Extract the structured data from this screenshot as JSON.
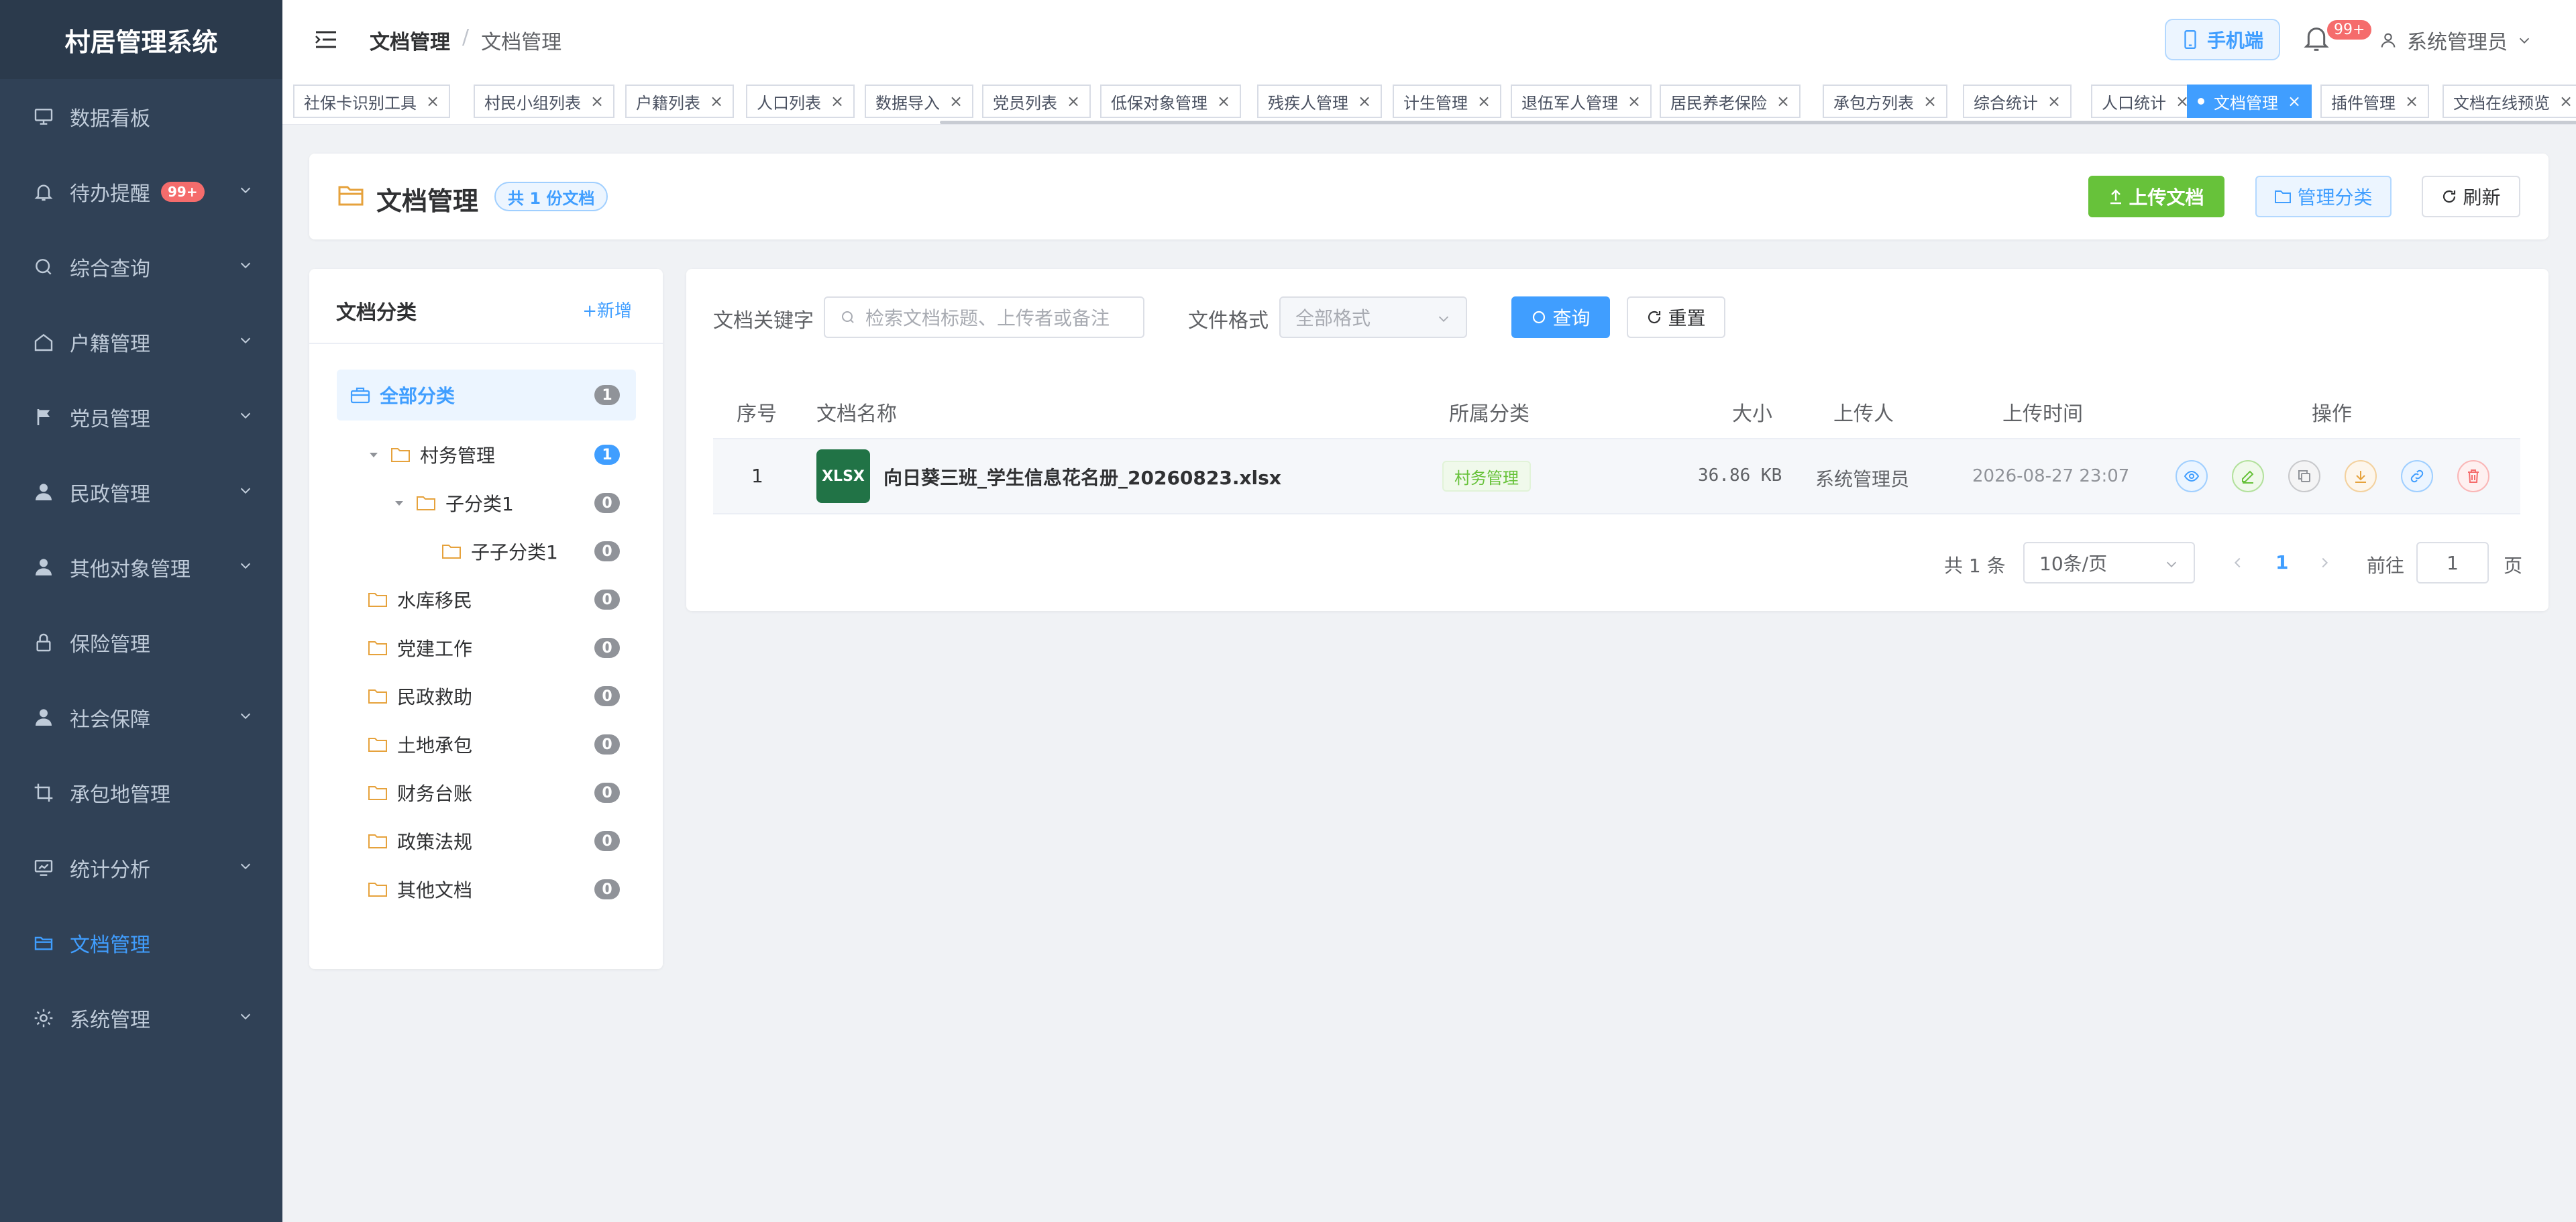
{
  "app": {
    "title": "村居管理系统"
  },
  "sidebar": {
    "items": [
      {
        "label": "数据看板",
        "icon": "monitor-icon",
        "has_children": false
      },
      {
        "label": "待办提醒",
        "icon": "bell-icon",
        "has_children": true,
        "badge": "99+"
      },
      {
        "label": "综合查询",
        "icon": "search-icon",
        "has_children": true
      },
      {
        "label": "户籍管理",
        "icon": "home-icon",
        "has_children": true
      },
      {
        "label": "党员管理",
        "icon": "flag-icon",
        "has_children": true
      },
      {
        "label": "民政管理",
        "icon": "user-icon",
        "has_children": true
      },
      {
        "label": "其他对象管理",
        "icon": "user-icon",
        "has_children": true
      },
      {
        "label": "保险管理",
        "icon": "lock-icon",
        "has_children": false
      },
      {
        "label": "社会保障",
        "icon": "user-icon",
        "has_children": true
      },
      {
        "label": "承包地管理",
        "icon": "crop-icon",
        "has_children": false
      },
      {
        "label": "统计分析",
        "icon": "chart-icon",
        "has_children": true
      },
      {
        "label": "文档管理",
        "icon": "folder-open-icon",
        "has_children": false,
        "active": true
      },
      {
        "label": "系统管理",
        "icon": "gear-icon",
        "has_children": true
      }
    ]
  },
  "header": {
    "breadcrumb": [
      "文档管理",
      "文档管理"
    ],
    "breadcrumb_sep": "/",
    "mobile_label": "手机端",
    "bell_badge": "99+",
    "user_name": "系统管理员"
  },
  "tags": [
    {
      "label": "社保卡识别工具",
      "active": false
    },
    {
      "label": "村民小组列表",
      "active": false
    },
    {
      "label": "户籍列表",
      "active": false
    },
    {
      "label": "人口列表",
      "active": false
    },
    {
      "label": "数据导入",
      "active": false
    },
    {
      "label": "党员列表",
      "active": false
    },
    {
      "label": "低保对象管理",
      "active": false
    },
    {
      "label": "残疾人管理",
      "active": false
    },
    {
      "label": "计生管理",
      "active": false
    },
    {
      "label": "退伍军人管理",
      "active": false
    },
    {
      "label": "居民养老保险",
      "active": false
    },
    {
      "label": "承包方列表",
      "active": false
    },
    {
      "label": "综合统计",
      "active": false
    },
    {
      "label": "人口统计",
      "active": false
    },
    {
      "label": "文档管理",
      "active": true
    },
    {
      "label": "插件管理",
      "active": false
    },
    {
      "label": "文档在线预览",
      "active": false
    }
  ],
  "page": {
    "title": "文档管理",
    "count_tag": "共 1 份文档",
    "upload_label": "上传文档",
    "manage_label": "管理分类",
    "refresh_label": "刷新"
  },
  "categories": {
    "title": "文档分类",
    "add_label": "新增",
    "nodes": [
      {
        "label": "全部分类",
        "count": "1",
        "level": 0,
        "selected": true
      },
      {
        "label": "村务管理",
        "count": "1",
        "level": 1,
        "expanded": true
      },
      {
        "label": "子分类1",
        "count": "0",
        "level": 2,
        "expanded": true
      },
      {
        "label": "子子分类1",
        "count": "0",
        "level": 3
      },
      {
        "label": "水库移民",
        "count": "0",
        "level": 1
      },
      {
        "label": "党建工作",
        "count": "0",
        "level": 1
      },
      {
        "label": "民政救助",
        "count": "0",
        "level": 1
      },
      {
        "label": "土地承包",
        "count": "0",
        "level": 1
      },
      {
        "label": "财务台账",
        "count": "0",
        "level": 1
      },
      {
        "label": "政策法规",
        "count": "0",
        "level": 1
      },
      {
        "label": "其他文档",
        "count": "0",
        "level": 1
      }
    ]
  },
  "filters": {
    "keyword_label": "文档关键字",
    "keyword_placeholder": "检索文档标题、上传者或备注",
    "format_label": "文件格式",
    "format_value": "全部格式",
    "query_label": "查询",
    "reset_label": "重置"
  },
  "table": {
    "columns": [
      "序号",
      "文档名称",
      "所属分类",
      "大小",
      "上传人",
      "上传时间",
      "操作"
    ],
    "rows": [
      {
        "index": "1",
        "file_type": "XLSX",
        "name": "向日葵三班_学生信息花名册_20260823.xlsx",
        "category": "村务管理",
        "size": "36.86 KB",
        "uploader": "系统管理员",
        "time": "2026-08-27 23:07",
        "actions": [
          "view-icon",
          "edit-icon",
          "copy-icon",
          "download-icon",
          "link-icon",
          "delete-icon"
        ]
      }
    ]
  },
  "pagination": {
    "total": "共 1 条",
    "page_size": "10条/页",
    "current": "1",
    "goto_label": "前往",
    "goto_value": "1",
    "page_suffix": "页"
  },
  "colors": {
    "primary": "#409eff",
    "success": "#67c23a",
    "warning": "#e6a23c",
    "danger": "#f56c6c",
    "sidebar_bg": "#304156"
  }
}
